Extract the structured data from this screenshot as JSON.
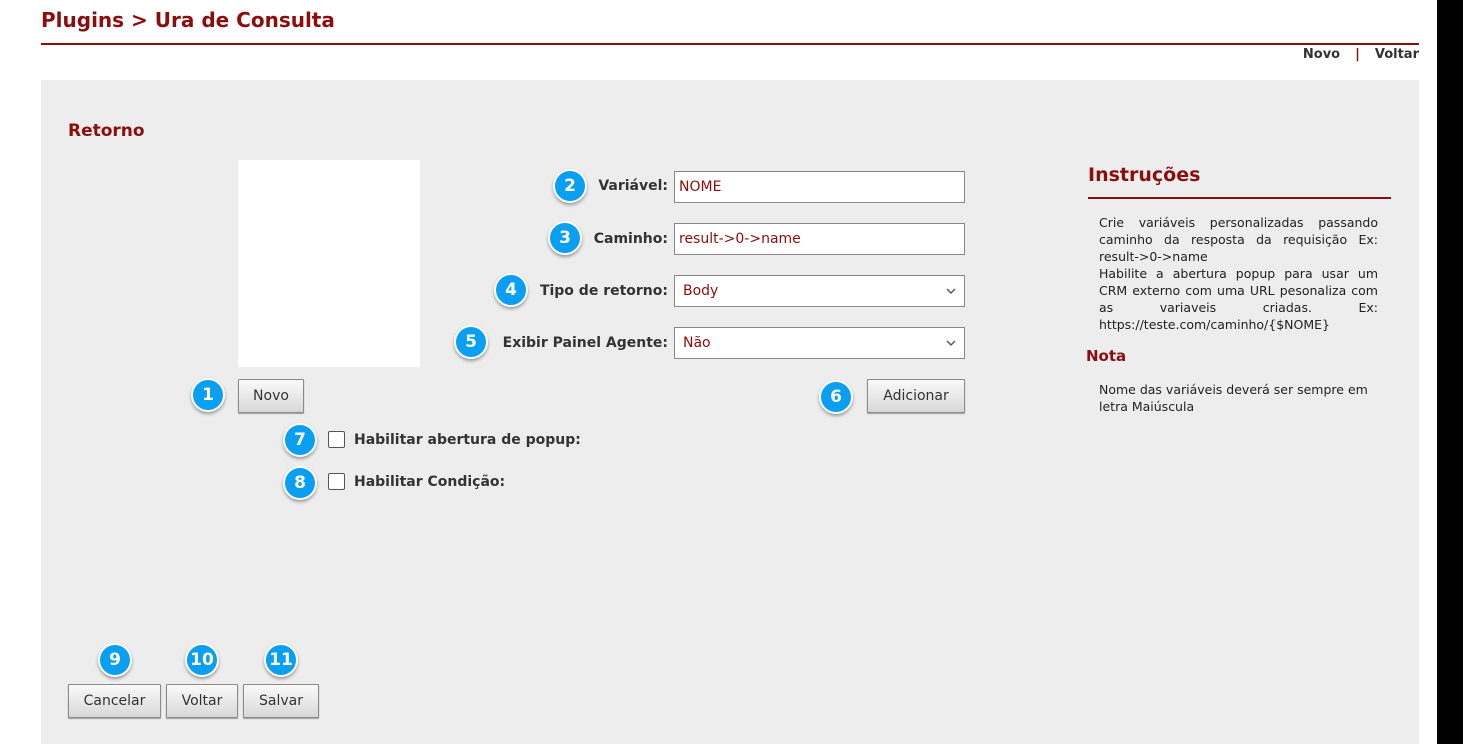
{
  "header": {
    "title": "Plugins > Ura de Consulta",
    "links": {
      "novo": "Novo",
      "separator": "|",
      "voltar": "Voltar"
    }
  },
  "section": {
    "title": "Retorno"
  },
  "buttons": {
    "novo": "Novo",
    "adicionar": "Adicionar",
    "cancelar": "Cancelar",
    "voltar": "Voltar",
    "salvar": "Salvar"
  },
  "form": {
    "variavel": {
      "label": "Variável:",
      "value": "NOME"
    },
    "caminho": {
      "label": "Caminho:",
      "value": "result->0->name"
    },
    "tipo_retorno": {
      "label": "Tipo de retorno:",
      "selected": "Body"
    },
    "exibir_painel": {
      "label": "Exibir Painel Agente:",
      "selected": "Não"
    }
  },
  "checkboxes": {
    "popup": {
      "label": "Habilitar abertura de popup:",
      "checked": false
    },
    "condicao": {
      "label": "Habilitar Condição:",
      "checked": false
    }
  },
  "instructions": {
    "title": "Instruções",
    "lines": [
      "Crie variáveis personalizadas passando caminho da resposta da requisição Ex: result->0->name",
      "Habilite a abertura popup para usar um CRM externo com uma URL pesonaliza com as variaveis criadas. Ex: https://teste.com/caminho/{$NOME}"
    ],
    "nota_title": "Nota",
    "nota_text": "Nome das variáveis deverá ser sempre em letra Maiúscula"
  },
  "badges": [
    "1",
    "2",
    "3",
    "4",
    "5",
    "6",
    "7",
    "8",
    "9",
    "10",
    "11"
  ],
  "colors": {
    "accent": "#8b0d0d",
    "badge": "#0a9ff0",
    "panel": "#ededed"
  }
}
